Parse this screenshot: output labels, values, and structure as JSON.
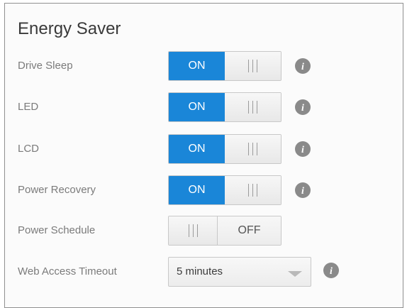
{
  "panel": {
    "title": "Energy Saver"
  },
  "settings": [
    {
      "label": "Drive Sleep",
      "state": "ON",
      "info_icon": "info-icon"
    },
    {
      "label": "LED",
      "state": "ON",
      "info_icon": "info-icon"
    },
    {
      "label": "LCD",
      "state": "ON",
      "info_icon": "info-icon"
    },
    {
      "label": "Power Recovery",
      "state": "ON",
      "info_icon": "info-icon"
    },
    {
      "label": "Power Schedule",
      "state": "OFF"
    }
  ],
  "web_access_timeout": {
    "label": "Web Access Timeout",
    "selected_value": "5 minutes",
    "info_icon": "info-icon"
  },
  "colors": {
    "toggle_on": "#1a86d8",
    "info_icon": "#8a8a8a"
  }
}
